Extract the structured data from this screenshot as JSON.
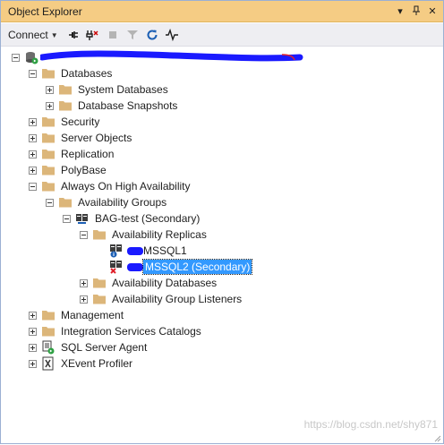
{
  "panel": {
    "title": "Object Explorer",
    "title_buttons": [
      {
        "name": "dropdown-icon",
        "glyph": "▾"
      },
      {
        "name": "pin-icon",
        "glyph": "⊥"
      },
      {
        "name": "close-icon",
        "glyph": "✕"
      }
    ]
  },
  "toolbar": {
    "connect_label": "Connect",
    "icons": [
      "connect-server-icon",
      "disconnect-icon",
      "stop-icon",
      "filter-icon",
      "refresh-icon",
      "activity-monitor-icon"
    ]
  },
  "tree": {
    "server_label": "",
    "databases": "Databases",
    "system_databases": "System Databases",
    "database_snapshots": "Database Snapshots",
    "security": "Security",
    "server_objects": "Server Objects",
    "replication": "Replication",
    "polybase": "PolyBase",
    "always_on": "Always On High Availability",
    "availability_groups": "Availability Groups",
    "ag_node": "BAG-test (Secondary)",
    "availability_replicas": "Availability Replicas",
    "replica1": "MSSQL1",
    "replica2": "MSSQL2 (Secondary)",
    "availability_databases": "Availability Databases",
    "ag_listeners": "Availability Group Listeners",
    "management": "Management",
    "integration_services": "Integration Services Catalogs",
    "sql_agent": "SQL Server Agent",
    "xevent": "XEvent Profiler"
  },
  "watermark": "https://blog.csdn.net/shy871",
  "colors": {
    "titlebar": "#f5cc84",
    "selection": "#3399ff",
    "folder": "#dcb67a",
    "redaction": "#1a1aff"
  }
}
